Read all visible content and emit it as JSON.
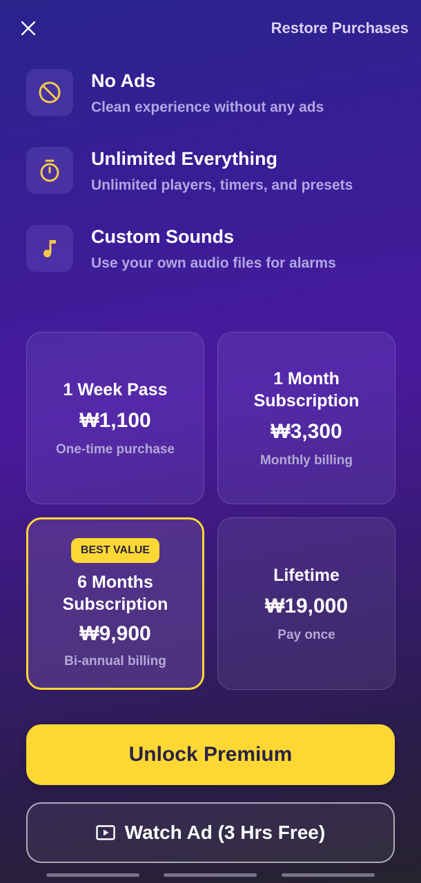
{
  "header": {
    "restore_label": "Restore Purchases",
    "close_icon": "close-icon"
  },
  "features": [
    {
      "icon": "no-ads-icon",
      "title": "No Ads",
      "desc": "Clean experience without any ads"
    },
    {
      "icon": "timer-icon",
      "title": "Unlimited Everything",
      "desc": "Unlimited players, timers, and presets"
    },
    {
      "icon": "music-note-icon",
      "title": "Custom Sounds",
      "desc": "Use your own audio files for alarms"
    }
  ],
  "plans": [
    {
      "title": "1 Week Pass",
      "price": "₩1,100",
      "note": "One-time purchase"
    },
    {
      "title": "1 Month Subscription",
      "price": "₩3,300",
      "note": "Monthly billing"
    },
    {
      "badge": "BEST VALUE",
      "title": "6 Months Subscription",
      "price": "₩9,900",
      "note": "Bi-annual billing",
      "selected": true
    },
    {
      "title": "Lifetime",
      "price": "₩19,000",
      "note": "Pay once"
    }
  ],
  "cta": {
    "unlock_label": "Unlock Premium",
    "watch_label": "Watch Ad (3 Hrs Free)",
    "watch_icon": "play-video-icon"
  },
  "colors": {
    "accent": "#fdd835",
    "icon_yellow": "#f5c84a",
    "subtitle": "#b3a6e3"
  }
}
